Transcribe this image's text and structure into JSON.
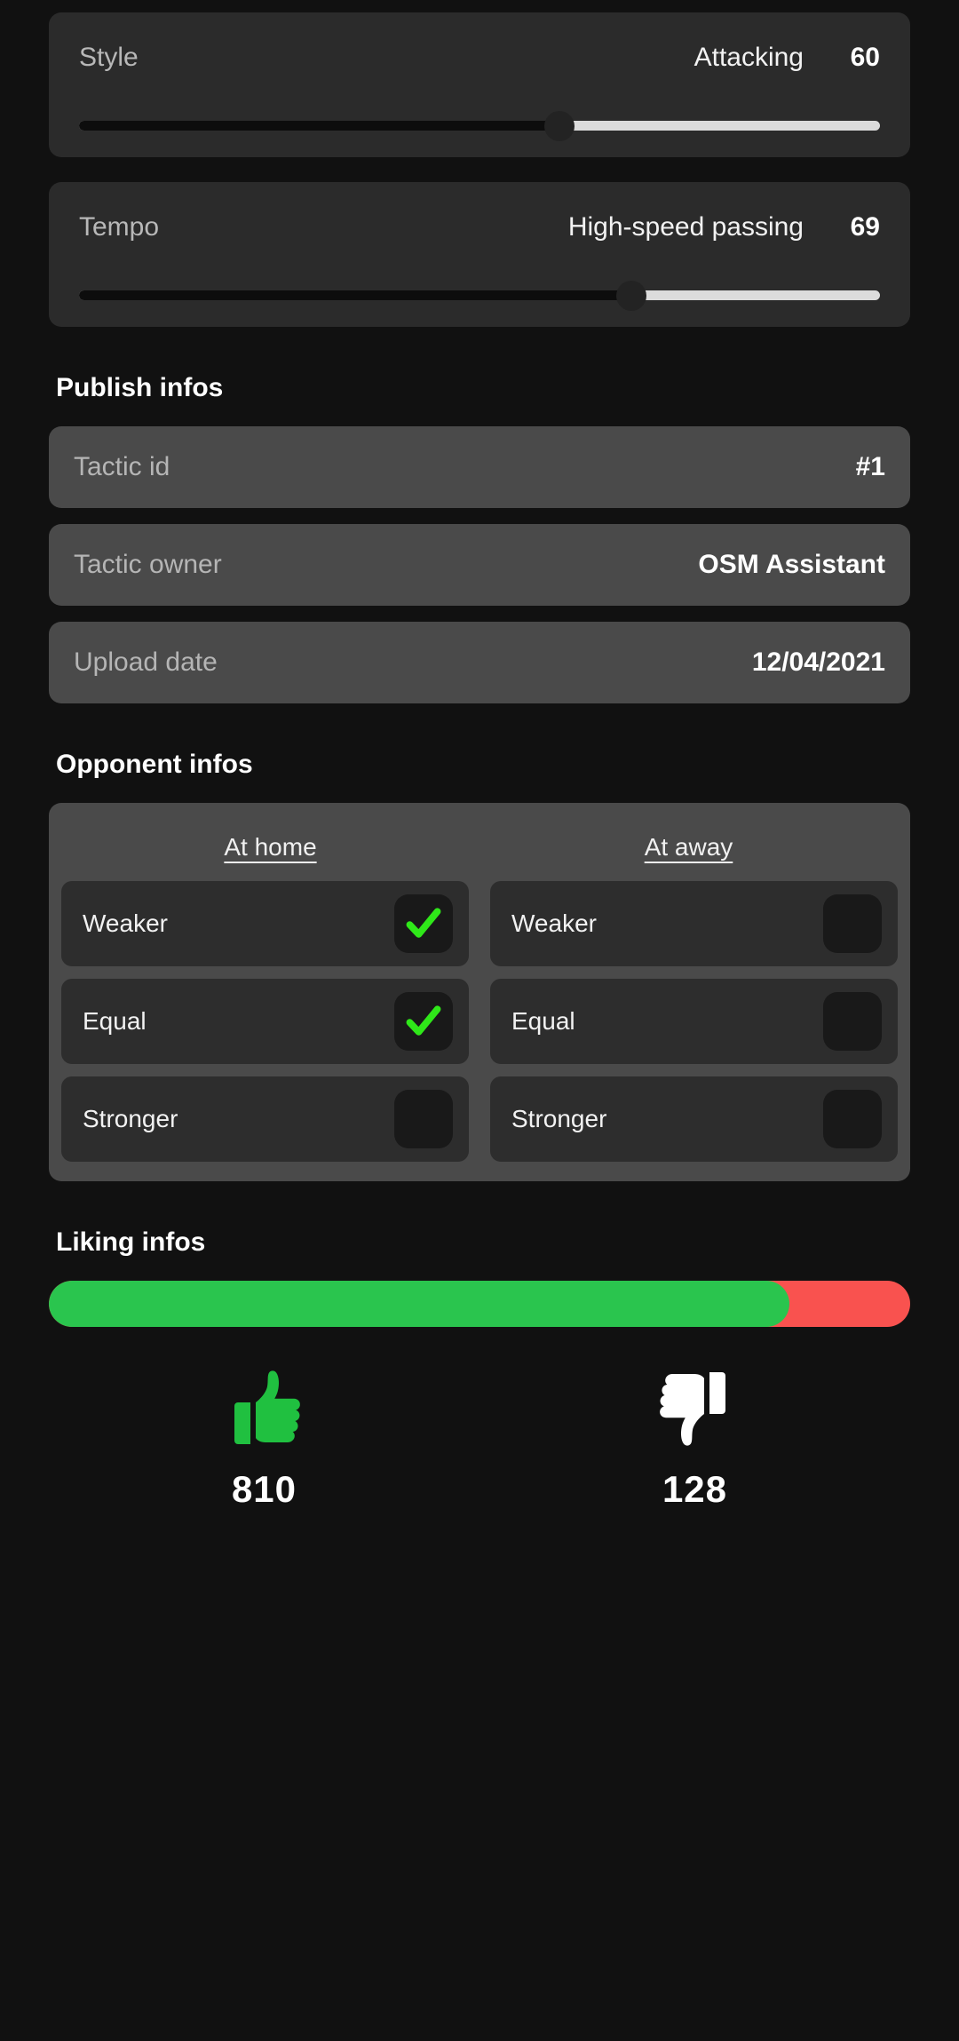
{
  "theme": {
    "page_bg": "#111111",
    "slider_card_bg": "#2b2b2b",
    "info_card_bg": "#4a4a4a",
    "opponent_row_bg": "#2d2d2d",
    "checkbox_bg": "#191919",
    "check_green": "#2FE819",
    "like_green": "#2ac54e",
    "dislike_red": "#f9524f",
    "thumb_up_color": "#20c040",
    "thumb_down_color": "#ffffff"
  },
  "sliders": [
    {
      "label": "Style",
      "value_text": "Attacking",
      "value_number": "60",
      "percent": 60
    },
    {
      "label": "Tempo",
      "value_text": "High-speed passing",
      "value_number": "69",
      "percent": 69
    }
  ],
  "publish": {
    "title": "Publish infos",
    "rows": [
      {
        "key": "Tactic id",
        "value": "#1"
      },
      {
        "key": "Tactic owner",
        "value": "OSM Assistant"
      },
      {
        "key": "Upload date",
        "value": "12/04/2021"
      }
    ]
  },
  "opponent": {
    "title": "Opponent infos",
    "columns": [
      "At home",
      "At away"
    ],
    "rows": [
      {
        "label_home": "Weaker",
        "checked_home": true,
        "label_away": "Weaker",
        "checked_away": false
      },
      {
        "label_home": "Equal",
        "checked_home": true,
        "label_away": "Equal",
        "checked_away": false
      },
      {
        "label_home": "Stronger",
        "checked_home": false,
        "label_away": "Stronger",
        "checked_away": false
      }
    ]
  },
  "liking": {
    "title": "Liking infos",
    "like_percent": 86,
    "likes": "810",
    "dislikes": "128",
    "like_icon": "thumbs-up-icon",
    "dislike_icon": "thumbs-down-icon"
  }
}
